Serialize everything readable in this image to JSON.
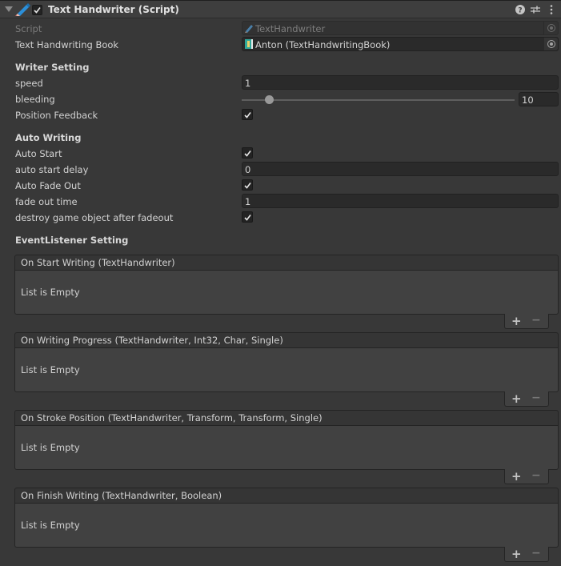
{
  "header": {
    "title": "Text Handwriter (Script)",
    "enabled": true,
    "icons": [
      "foldout-arrow-icon",
      "pencil-script-icon",
      "help-icon",
      "presets-icon",
      "kebab-menu-icon"
    ]
  },
  "fields": {
    "script": {
      "label": "Script",
      "value": "TextHandwriter",
      "icon": "pencil-script-icon"
    },
    "book": {
      "label": "Text Handwriting Book",
      "value": "Anton (TextHandwritingBook)",
      "icon": "book-asset-icon"
    }
  },
  "writer_setting": {
    "title": "Writer Setting",
    "speed": {
      "label": "speed",
      "value": "1"
    },
    "bleeding": {
      "label": "bleeding",
      "value": "10",
      "slider_fraction": 0.1
    },
    "position_feedback": {
      "label": "Position Feedback",
      "checked": true
    }
  },
  "auto_writing": {
    "title": "Auto Writing",
    "auto_start": {
      "label": "Auto Start",
      "checked": true
    },
    "auto_start_delay": {
      "label": "auto start delay",
      "value": "0"
    },
    "auto_fade_out": {
      "label": "Auto Fade Out",
      "checked": true
    },
    "fade_out_time": {
      "label": "fade out time",
      "value": "1"
    },
    "destroy_after_fadeout": {
      "label": "destroy game object after fadeout",
      "checked": true
    }
  },
  "event_setting": {
    "title": "EventListener Setting",
    "events": [
      {
        "title": "On Start Writing (TextHandwriter)",
        "empty_text": "List is Empty",
        "add": "+",
        "remove": "−"
      },
      {
        "title": "On Writing Progress (TextHandwriter, Int32, Char, Single)",
        "empty_text": "List is Empty",
        "add": "+",
        "remove": "−"
      },
      {
        "title": "On Stroke Position (TextHandwriter, Transform, Transform, Single)",
        "empty_text": "List is Empty",
        "add": "+",
        "remove": "−"
      },
      {
        "title": "On Finish Writing (TextHandwriter, Boolean)",
        "empty_text": "List is Empty",
        "add": "+",
        "remove": "−"
      }
    ]
  }
}
